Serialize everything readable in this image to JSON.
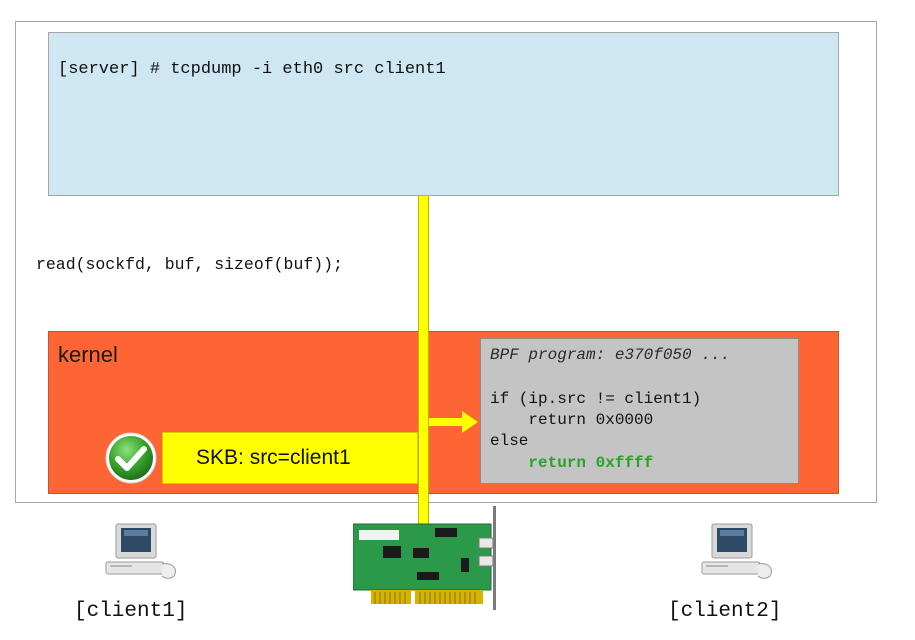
{
  "server": {
    "command": "[server] # tcpdump -i eth0 src client1",
    "syscall": "read(sockfd, buf, sizeof(buf));",
    "kernel_label": "kernel"
  },
  "bpf": {
    "title": "BPF program: e370f050 ...",
    "lines": [
      "if (ip.src != client1)",
      "    return 0x0000",
      "else",
      "    return 0xffff"
    ]
  },
  "skb": {
    "label": "SKB: src=client1"
  },
  "clients": [
    {
      "label": "[client1]"
    },
    {
      "label": "[client2]"
    }
  ],
  "colors": {
    "userspace_bg": "#cfe6f3",
    "kernel_bg": "#fd6634",
    "packet_path": "#ffff00",
    "bpf_bg": "#c4c4c4",
    "accept_return": "#2aa12a"
  },
  "icons": {
    "accepted": "green-checkmark-icon",
    "computer": "desktop-computer-icon",
    "network_card": "network-interface-card-icon"
  }
}
